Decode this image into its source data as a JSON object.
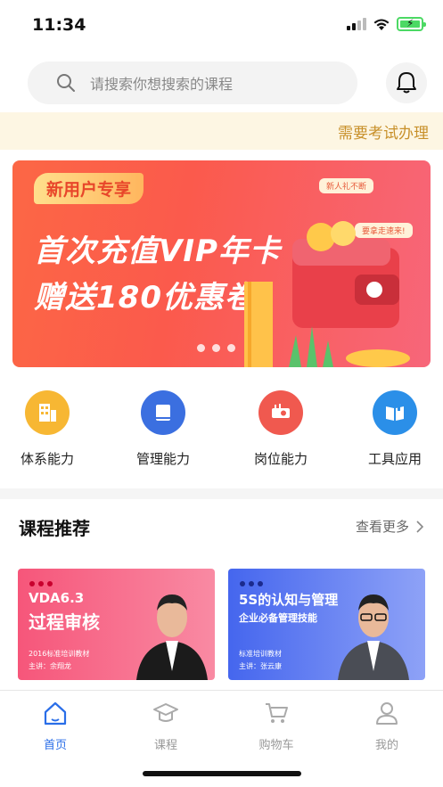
{
  "status": {
    "time": "11:34"
  },
  "search": {
    "placeholder": "请搜索你想搜索的课程"
  },
  "notice": {
    "text": "需要考试办理"
  },
  "banner": {
    "tag": "新用户专享",
    "line1": "首次充值VIP年卡",
    "line2": "赠送180优惠卷",
    "badge1": "新人礼不断",
    "badge2": "要拿走速来!",
    "slide_count": 3,
    "active_slide": 1
  },
  "categories": [
    {
      "label": "体系能力",
      "icon": "building-icon",
      "color": "#f7b733"
    },
    {
      "label": "管理能力",
      "icon": "book-icon",
      "color": "#3b6fe0"
    },
    {
      "label": "岗位能力",
      "icon": "projector-icon",
      "color": "#f0594f"
    },
    {
      "label": "工具应用",
      "icon": "open-book-icon",
      "color": "#2b8fe8"
    }
  ],
  "courses_section": {
    "title": "课程推荐",
    "more_label": "查看更多",
    "items": [
      {
        "title_line1": "VDA6.3",
        "title_line2": "过程审核",
        "sub1": "2016标准培训教材",
        "sub2": "主讲：余翔龙",
        "bg": "#f25a7d"
      },
      {
        "title_line1": "5S的认知与管理",
        "title_line2": "企业必备管理技能",
        "sub1": "标准培训教材",
        "sub2": "主讲：张云康",
        "bg": "#4f6ef0"
      }
    ]
  },
  "tabs": [
    {
      "label": "首页",
      "icon": "home-icon",
      "active": true
    },
    {
      "label": "课程",
      "icon": "graduation-cap-icon",
      "active": false
    },
    {
      "label": "购物车",
      "icon": "cart-icon",
      "active": false
    },
    {
      "label": "我的",
      "icon": "user-icon",
      "active": false
    }
  ]
}
